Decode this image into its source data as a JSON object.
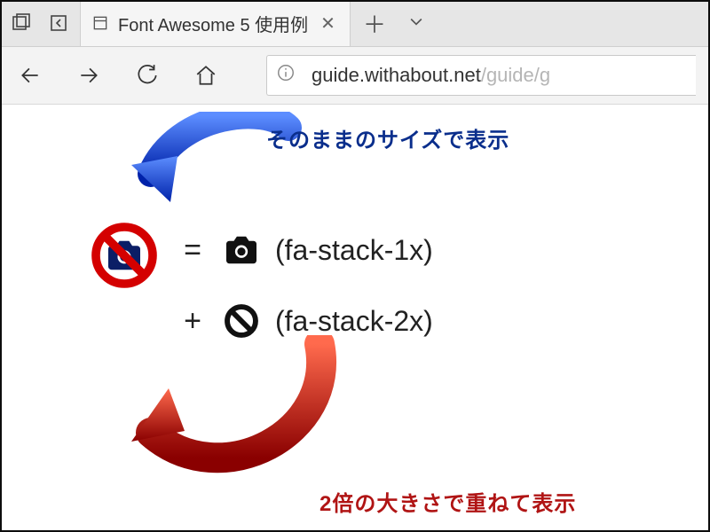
{
  "browser": {
    "tab_title": "Font Awesome 5 使用例",
    "url_host": "guide.withabout.net",
    "url_path": "/guide/g"
  },
  "content": {
    "annotation_top": "そのままのサイズで表示",
    "annotation_bottom": "2倍の大きさで重ねて表示",
    "line1": {
      "operator": "=",
      "icon_name": "camera-icon",
      "label": "(fa-stack-1x)"
    },
    "line2": {
      "operator": "+",
      "icon_name": "ban-icon",
      "label": "(fa-stack-2x)"
    },
    "stacked_icon": {
      "base_icon": "camera-icon",
      "overlay_icon": "ban-icon",
      "overlay_color": "#d40000",
      "base_color": "#0b1e66"
    },
    "colors": {
      "arrow_top": "#0033cc",
      "arrow_bottom": "#b01414"
    }
  }
}
